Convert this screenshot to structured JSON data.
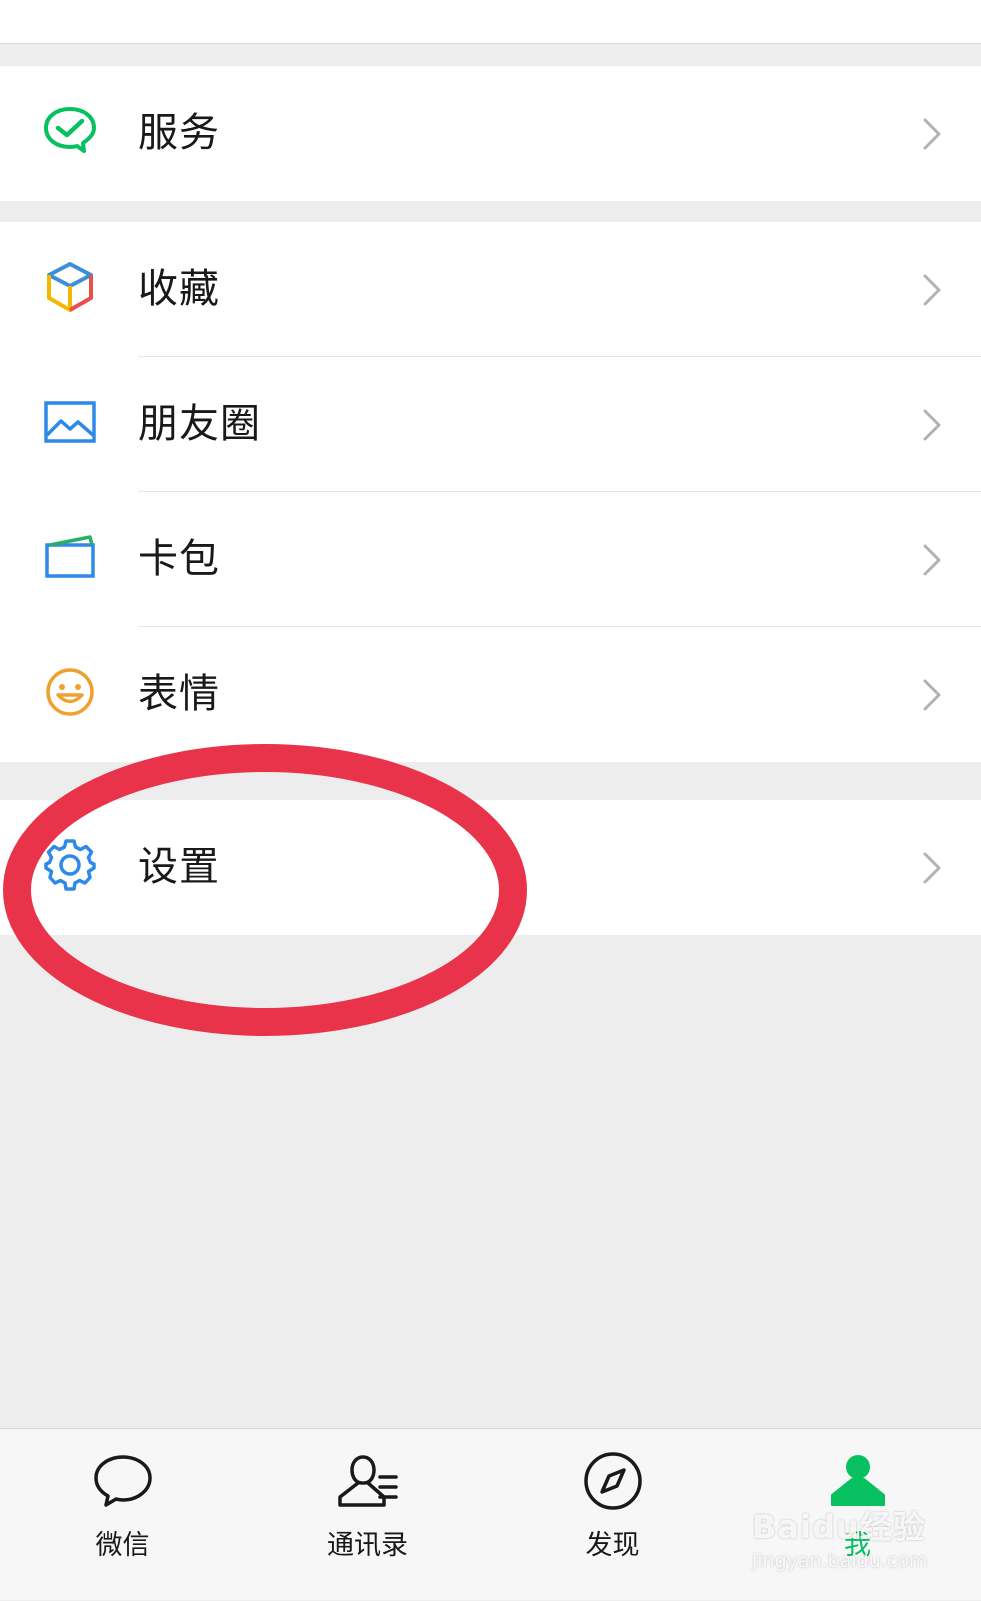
{
  "menu": {
    "service": {
      "label": "服务",
      "icon": "wechat-pay-icon"
    },
    "favorites": {
      "label": "收藏",
      "icon": "cube-icon"
    },
    "moments": {
      "label": "朋友圈",
      "icon": "image-icon"
    },
    "cards": {
      "label": "卡包",
      "icon": "card-icon"
    },
    "stickers": {
      "label": "表情",
      "icon": "smile-icon"
    },
    "settings": {
      "label": "设置",
      "icon": "gear-icon"
    }
  },
  "tabbar": {
    "tabs": [
      {
        "label": "微信",
        "icon": "chat-bubble-icon",
        "active": false
      },
      {
        "label": "通讯录",
        "icon": "contacts-icon",
        "active": false
      },
      {
        "label": "发现",
        "icon": "compass-icon",
        "active": false
      },
      {
        "label": "我",
        "icon": "person-icon",
        "active": true
      }
    ]
  },
  "watermark": {
    "brand": "Baidu经验",
    "url": "jingyan.baidu.com"
  },
  "colors": {
    "accent": "#07c160",
    "annotation": "#e8334a",
    "background": "#ededed"
  }
}
